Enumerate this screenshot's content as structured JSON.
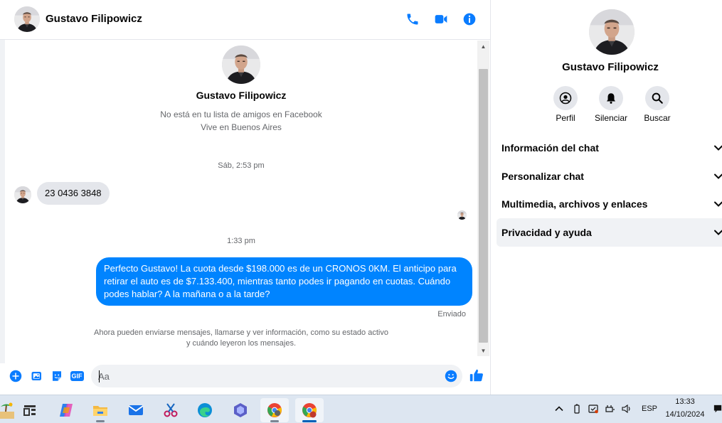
{
  "contact": {
    "name": "Gustavo Filipowicz",
    "friend_status": "No está en tu lista de amigos en Facebook",
    "location": "Vive en Buenos Aires"
  },
  "header": {
    "icons": [
      "phone-icon",
      "video-icon",
      "info-icon"
    ]
  },
  "conversation": {
    "separators": [
      "Sáb, 2:53 pm",
      "1:33 pm"
    ],
    "incoming_message": "23 0436 3848",
    "outgoing_message": "Perfecto Gustavo!  La cuota desde $198.000 es de un CRONOS 0KM. El anticipo para retirar el auto es de $7.133.400, mientras tanto podes ir pagando en cuotas. Cuándo podes hablar? A la mañana o a la tarde?",
    "sent_status": "Enviado",
    "notice_line1": "Ahora pueden enviarse mensajes, llamarse y ver información, como su estado activo",
    "notice_line2": "y cuándo leyeron los mensajes."
  },
  "composer": {
    "placeholder": "Aa",
    "gif_label": "GIF",
    "icons": [
      "plus-icon",
      "image-icon",
      "sticker-icon",
      "gif-icon",
      "emoji-icon",
      "like-icon"
    ]
  },
  "info_panel": {
    "actions": [
      {
        "label": "Perfil",
        "icon": "profile-icon"
      },
      {
        "label": "Silenciar",
        "icon": "bell-icon"
      },
      {
        "label": "Buscar",
        "icon": "search-icon"
      }
    ],
    "sections": [
      "Información del chat",
      "Personalizar chat",
      "Multimedia, archivos y enlaces",
      "Privacidad y ayuda"
    ]
  },
  "taskbar": {
    "apps": [
      "beach-icon",
      "widgets-icon",
      "copilot-icon",
      "file-explorer-icon",
      "mail-icon",
      "snipping-tool-icon",
      "edge-icon",
      "teams-icon",
      "chrome-icon",
      "chrome-profile-icon"
    ],
    "language": "ESP",
    "time": "13:33",
    "date": "14/10/2024"
  },
  "colors": {
    "accent": "#0084ff",
    "bubble_in": "#e4e6eb",
    "muted_text": "#65676b"
  }
}
